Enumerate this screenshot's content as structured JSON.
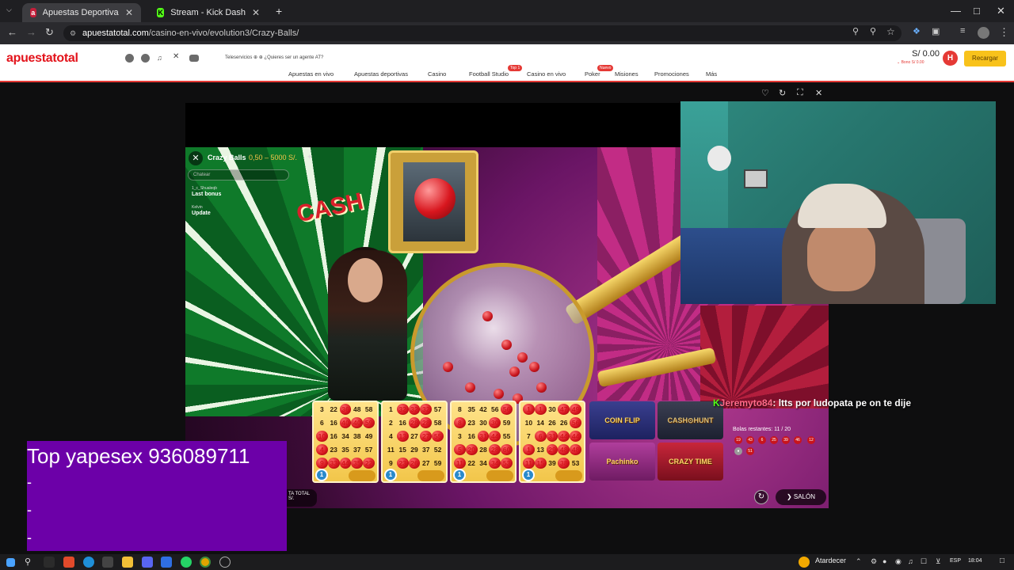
{
  "browser": {
    "tabs": [
      {
        "label": "Apuestas Deportivas Online | A",
        "favicon_color": "#c41e3a"
      },
      {
        "label": "Stream - Kick Dashboard",
        "favicon_color": "#53fc18"
      }
    ],
    "url_host": "apuestatotal.com",
    "url_path": "/casino-en-vivo/evolution3/Crazy-Balls/"
  },
  "site": {
    "logo": "apuestatotal",
    "teleservicios": "Teleservicios ⊕ ⊕  ¿Quieres ser un agente AT?",
    "nav": [
      "Apuestas en vivo",
      "Apuestas deportivas",
      "Casino",
      "Football Studio",
      "Casino en vivo",
      "Poker",
      "Misiones",
      "Promociones",
      "Más"
    ],
    "badges": {
      "football": "Top 1",
      "poker": "Nuevo"
    },
    "balance": "S/ 0.00",
    "bono": "⌄ Bono S/ 0.00",
    "avatar_letter": "H",
    "recargar": "Recargar"
  },
  "game": {
    "title": "Crazy Balls",
    "limits": "0,50 – 5000 S/.",
    "chat_placeholder": "Chatear",
    "chat": [
      {
        "user": "1_c_Shualeqb",
        "msg": "Last bonus"
      },
      {
        "user": "Kelvin",
        "msg": "Update"
      }
    ],
    "sign": "CASH",
    "cards": [
      {
        "numbers": [
          3,
          22,
          36,
          48,
          58,
          6,
          16,
          40,
          40,
          59,
          10,
          16,
          34,
          38,
          49,
          4,
          23,
          35,
          37,
          57,
          9,
          33,
          44,
          35,
          22
        ],
        "marked": [
          2,
          7,
          8,
          9,
          10,
          15,
          20,
          21,
          22,
          23,
          24
        ],
        "coin": "1"
      },
      {
        "numbers": [
          1,
          32,
          32,
          32,
          57,
          2,
          16,
          28,
          28,
          58,
          4,
          13,
          27,
          27,
          55,
          11,
          15,
          29,
          37,
          52,
          9,
          23,
          26,
          27,
          59
        ],
        "marked": [
          1,
          2,
          3,
          7,
          8,
          11,
          13,
          14,
          21,
          22
        ],
        "coin": "1"
      },
      {
        "numbers": [
          8,
          35,
          42,
          56,
          56,
          8,
          23,
          30,
          30,
          59,
          3,
          16,
          31,
          44,
          55,
          5,
          20,
          28,
          28,
          60,
          11,
          22,
          34,
          34,
          53
        ],
        "marked": [
          4,
          5,
          8,
          12,
          13,
          15,
          16,
          18,
          19,
          20,
          23,
          24
        ],
        "coin": "1"
      },
      {
        "numbers": [
          1,
          1,
          30,
          47,
          49,
          10,
          14,
          26,
          26,
          56,
          7,
          6,
          31,
          44,
          44,
          1,
          13,
          29,
          48,
          48,
          11,
          15,
          39,
          38,
          53
        ],
        "marked": [
          0,
          1,
          3,
          4,
          9,
          11,
          12,
          13,
          14,
          15,
          17,
          18,
          19,
          20,
          21,
          23
        ],
        "coin": "1"
      }
    ],
    "tiles": {
      "coinflip": "COIN FLIP",
      "cashhunt": "CASH⊙HUNT",
      "pachinko": "Pachinko",
      "crazytime": "CRAZY TIME"
    },
    "remaining_label": "Bolas restantes: 11 / 20",
    "drawn": [
      "19",
      "43",
      "6",
      "25",
      "39",
      "46",
      "12"
    ],
    "extra_drawn": [
      "51"
    ],
    "casa_total": "TA TOTAL\nS/.",
    "salon": "SALÓN"
  },
  "stream_chat": {
    "user": "Jeremyto84",
    "message": ": ltts por ludopata pe on te dije"
  },
  "promo": {
    "title": "Top yapesex 936089711",
    "lines": [
      "-",
      "-",
      "-"
    ]
  },
  "taskbar": {
    "weather": "Atardecer",
    "lang": "ESP",
    "time": "18:04"
  },
  "colors": {
    "brand_red": "#e3131b",
    "recargar_yellow": "#f8c21b",
    "promo_purple": "#6c00a8"
  }
}
